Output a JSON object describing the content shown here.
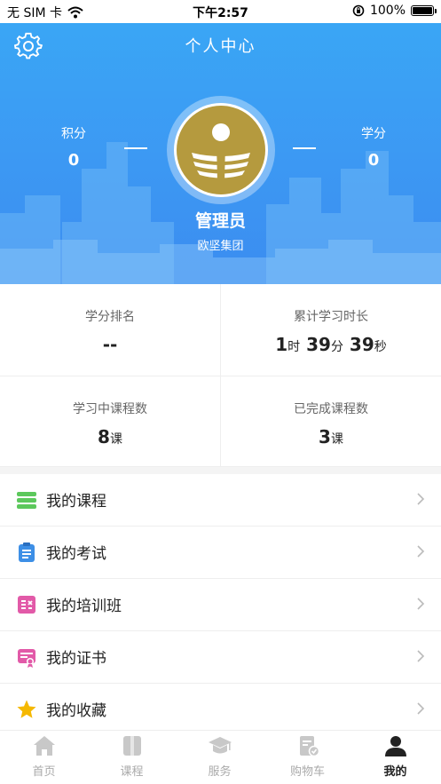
{
  "status_bar": {
    "carrier": "无 SIM 卡",
    "time": "下午2:57",
    "battery": "100%"
  },
  "header": {
    "title": "个人中心",
    "points_label": "积分",
    "points_value": "0",
    "credits_label": "学分",
    "credits_value": "0",
    "user_name": "管理员",
    "organization": "欧坚集团"
  },
  "stats": {
    "rank_label": "学分排名",
    "rank_value": "--",
    "study_time_label": "累计学习时长",
    "study_time": {
      "hours": "1",
      "hours_unit": "时",
      "minutes": "39",
      "minutes_unit": "分",
      "seconds": "39",
      "seconds_unit": "秒"
    },
    "in_progress_label": "学习中课程数",
    "in_progress_value": "8",
    "in_progress_unit": "课",
    "completed_label": "已完成课程数",
    "completed_value": "3",
    "completed_unit": "课"
  },
  "menu": {
    "items": [
      {
        "label": "我的课程",
        "icon": "course-stack-icon",
        "color": "#5cc85c"
      },
      {
        "label": "我的考试",
        "icon": "exam-clipboard-icon",
        "color": "#3d8fe6"
      },
      {
        "label": "我的培训班",
        "icon": "training-class-icon",
        "color": "#e25aa8"
      },
      {
        "label": "我的证书",
        "icon": "certificate-icon",
        "color": "#e25aa8"
      },
      {
        "label": "我的收藏",
        "icon": "star-icon",
        "color": "#f5b800"
      }
    ]
  },
  "tabbar": {
    "tabs": [
      {
        "label": "首页",
        "icon": "home-icon",
        "active": false
      },
      {
        "label": "课程",
        "icon": "book-icon",
        "active": false
      },
      {
        "label": "服务",
        "icon": "graduation-cap-icon",
        "active": false
      },
      {
        "label": "购物车",
        "icon": "cart-doc-icon",
        "active": false
      },
      {
        "label": "我的",
        "icon": "person-icon",
        "active": true
      }
    ]
  },
  "colors": {
    "header_blue": "#3c98f3",
    "logo_gold": "#b59a3e",
    "active_tab": "#222222",
    "inactive_tab": "#aaaaaa"
  }
}
